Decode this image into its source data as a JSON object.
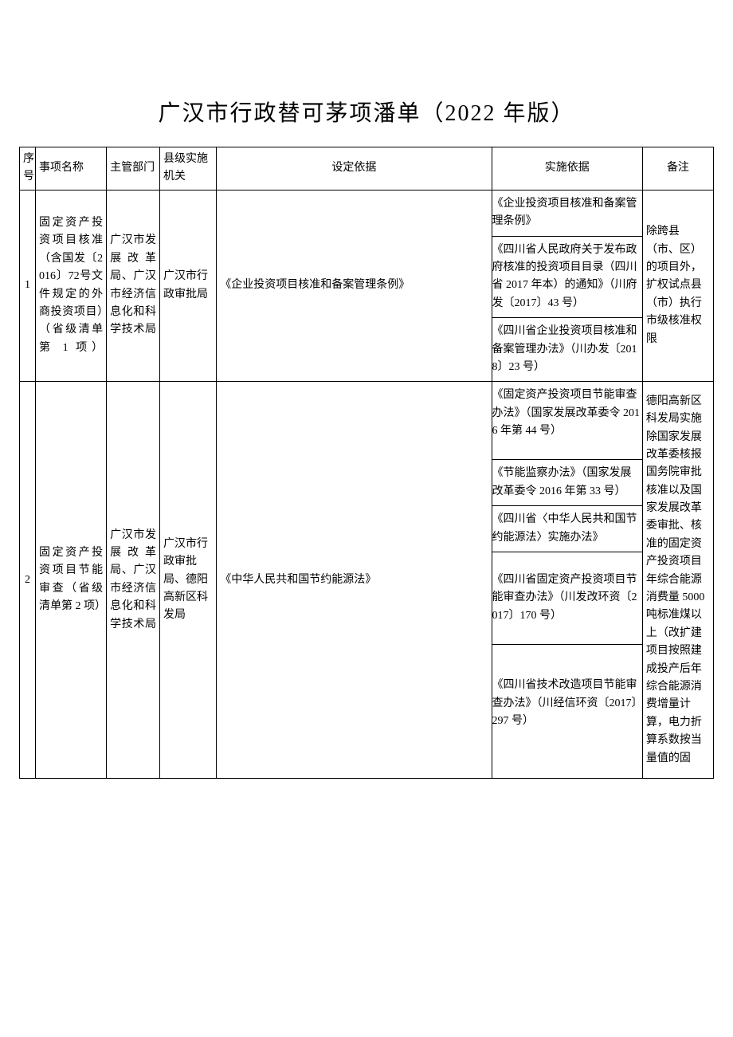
{
  "title": "广汉市行政替可茅项潘单（2022 年版）",
  "headers": {
    "seq": "序号",
    "name": "事项名称",
    "dept": "主管部门",
    "agency": "县级实施机关",
    "basis": "设定依据",
    "impl": "实施依据",
    "note": "备注"
  },
  "rows": [
    {
      "seq": "1",
      "name": "固定资产投资项目核准（含国发〔2016〕72号文件规定的外商投资项目）（省级清单第 1 项）",
      "dept": "广汉市发展改革局、广汉市经济信息化和科学技术局",
      "agency": "广汉市行政审批局",
      "basis": "《企业投资项目核准和备案管理条例》",
      "impl": [
        "《企业投资项目核准和备案管理条例》",
        "《四川省人民政府关于发布政府核准的投资项目目录（四川省 2017 年本）的通知》（川府发〔2017〕43 号）",
        "《四川省企业投资项目核准和备案管理办法》（川办发〔2018〕23 号）"
      ],
      "note": "除跨县（市、区）的项目外，扩权试点县（市）执行市级核准权限"
    },
    {
      "seq": "2",
      "name": "固定资产投资项目节能审查（省级清单第 2 项）",
      "dept": "广汉市发展改革局、广汉市经济信息化和科学技术局",
      "agency": "广汉市行政审批局、德阳高新区科发局",
      "basis": "《中华人民共和国节约能源法》",
      "impl": [
        "《固定资产投资项目节能审查办法》（国家发展改革委令 2016 年第 44 号）",
        "《节能监察办法》（国家发展改革委令 2016 年第 33 号）",
        "《四川省〈中华人民共和国节约能源法〉实施办法》",
        "《四川省固定资产投资项目节能审查办法》（川发改环资〔2017〕170 号）",
        "《四川省技术改造项目节能审查办法》（川经信环资〔2017〕297 号）"
      ],
      "note": "德阳高新区科发局实施除国家发展改革委核报国务院审批核准以及国家发展改革委审批、核准的固定资产投资项目年综合能源消费量 5000 吨标准煤以上（改扩建项目按照建成投产后年综合能源消费增量计算，电力折算系数按当量值的固"
    }
  ]
}
